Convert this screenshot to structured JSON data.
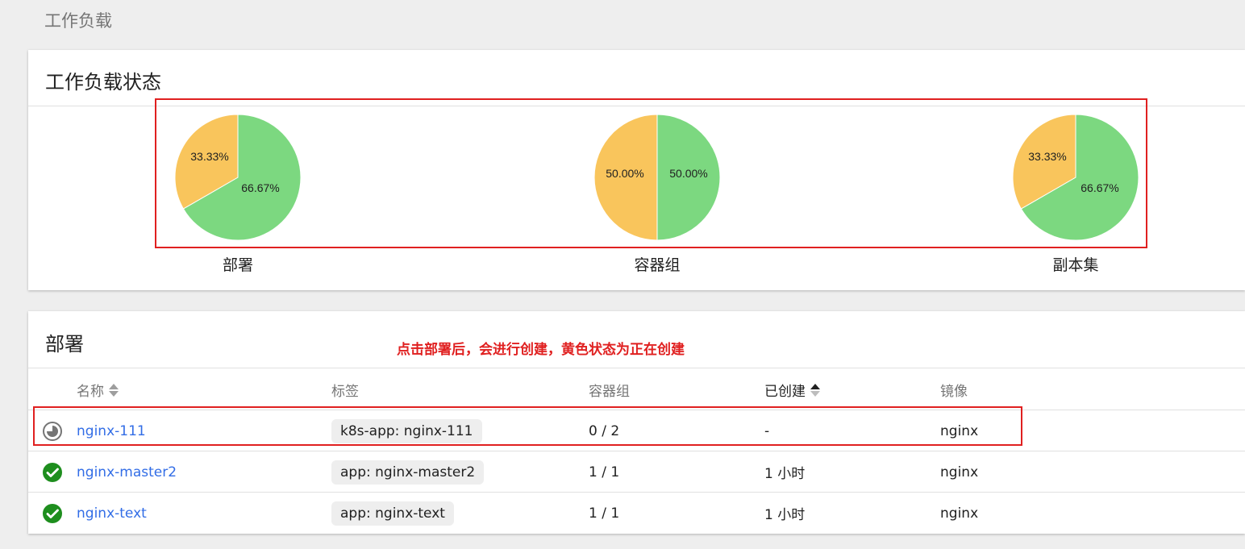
{
  "page": {
    "heading": "工作负载"
  },
  "status_card": {
    "title": "工作负载状态",
    "charts": [
      {
        "label": "部署",
        "slices": [
          {
            "value": 66.67,
            "label": "66.67%",
            "color": "#7cd880"
          },
          {
            "value": 33.33,
            "label": "33.33%",
            "color": "#f9c55c"
          }
        ]
      },
      {
        "label": "容器组",
        "slices": [
          {
            "value": 50.0,
            "label": "50.00%",
            "color": "#7cd880"
          },
          {
            "value": 50.0,
            "label": "50.00%",
            "color": "#f9c55c"
          }
        ]
      },
      {
        "label": "副本集",
        "slices": [
          {
            "value": 66.67,
            "label": "66.67%",
            "color": "#7cd880"
          },
          {
            "value": 33.33,
            "label": "33.33%",
            "color": "#f9c55c"
          }
        ]
      }
    ]
  },
  "deploy_card": {
    "title": "部署",
    "annotation": "点击部署后，会进行创建，黄色状态为正在创建",
    "columns": {
      "name": "名称",
      "labels": "标签",
      "pods": "容器组",
      "created": "已创建",
      "image": "镜像"
    },
    "rows": [
      {
        "status": "pending",
        "name": "nginx-111",
        "label": "k8s-app: nginx-111",
        "pods": "0 / 2",
        "created": "-",
        "image": "nginx"
      },
      {
        "status": "running",
        "name": "nginx-master2",
        "label": "app: nginx-master2",
        "pods": "1 / 1",
        "created": "1 小时",
        "image": "nginx"
      },
      {
        "status": "running",
        "name": "nginx-text",
        "label": "app: nginx-text",
        "pods": "1 / 1",
        "created": "1 小时",
        "image": "nginx"
      }
    ]
  },
  "colors": {
    "running": "#7cd880",
    "pending": "#f9c55c",
    "link": "#326de6",
    "ok_icon": "#1e8e1e",
    "annotation": "#e02020"
  }
}
